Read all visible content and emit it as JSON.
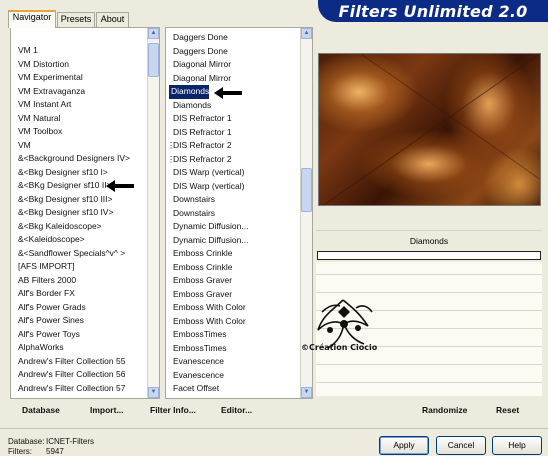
{
  "window": {
    "title": "Filters Unlimited 2.0"
  },
  "tabs": [
    {
      "label": "Navigator",
      "active": true
    },
    {
      "label": "Presets",
      "active": false
    },
    {
      "label": "About",
      "active": false
    }
  ],
  "categories": {
    "items": [
      "VM 1",
      "VM Distortion",
      "VM Experimental",
      "VM Extravaganza",
      "VM Instant Art",
      "VM Natural",
      "VM Toolbox",
      "VM",
      "&<Background Designers IV>",
      "&<Bkg Designer sf10 I>",
      "&<BKg Designer sf10 II>",
      "&<Bkg Designer sf10 III>",
      "&<Bkg Designer sf10 IV>",
      "&<Bkg Kaleidoscope>",
      "&<Kaleidoscope>",
      "&<Sandflower Specials^v^ >",
      "[AFS IMPORT]",
      "AB Filters 2000",
      "Alf's Border FX",
      "Alf's Power Grads",
      "Alf's Power Sines",
      "Alf's Power Toys",
      "AlphaWorks",
      "Andrew's Filter Collection 55",
      "Andrew's Filter Collection 56",
      "Andrew's Filter Collection 57"
    ]
  },
  "filters": {
    "items": [
      "Daggers Done",
      "Daggers Done",
      "Diagonal Mirror",
      "Diagonal Mirror",
      "Diamonds",
      "Diamonds",
      "DIS Refractor 1",
      "DIS Refractor 1",
      "DIS Refractor 2",
      "DIS Refractor 2",
      "DIS Warp (vertical)",
      "DIS Warp (vertical)",
      "Downstairs",
      "Downstairs",
      "Dynamic Diffusion...",
      "Dynamic Diffusion...",
      "Emboss Crinkle",
      "Emboss Crinkle",
      "Emboss Graver",
      "Emboss Graver",
      "Emboss With Color",
      "Emboss With Color",
      "EmbossTimes",
      "EmbossTimes",
      "Evanescence",
      "Evanescence",
      "Facet Offset"
    ],
    "selected": "Diamonds"
  },
  "preview": {
    "filter_name": "Diamonds",
    "progress": 0,
    "watermark": "©Création Ciocio"
  },
  "toolbar": {
    "database": "Database",
    "import": "Import...",
    "filter_info": "Filter Info...",
    "editor": "Editor...",
    "randomize": "Randomize",
    "reset": "Reset"
  },
  "status": {
    "database_label": "Database:",
    "database_value": "ICNET-Filters",
    "filters_label": "Filters:",
    "filters_value": "5947"
  },
  "buttons": {
    "apply": "Apply",
    "cancel": "Cancel",
    "help": "Help"
  },
  "colors": {
    "banner": "#0b2b86",
    "selection": "#0a246a",
    "arrow": "#000000"
  }
}
